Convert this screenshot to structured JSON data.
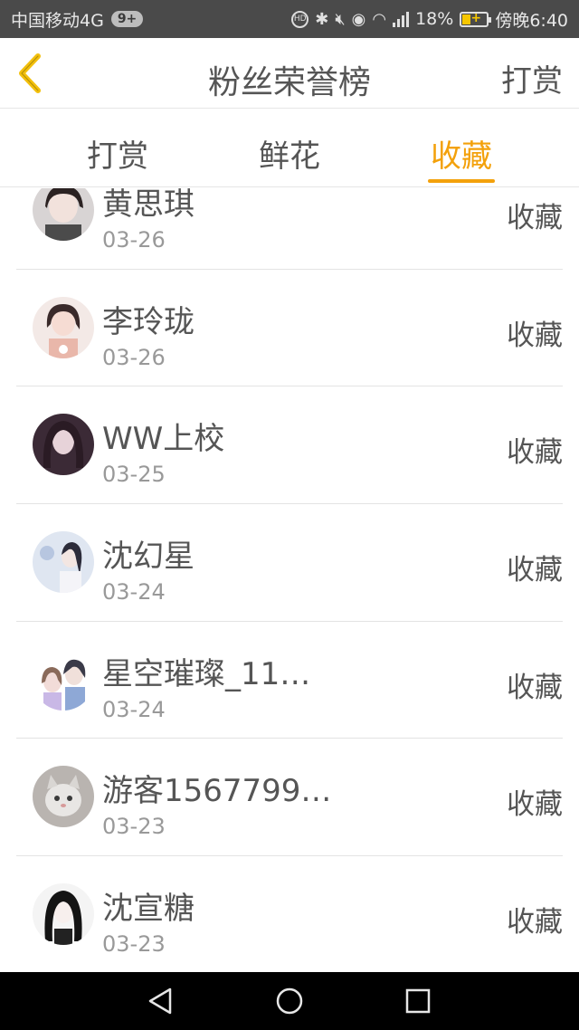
{
  "status_bar": {
    "carrier": "中国移动4G",
    "badge": "9+",
    "battery": "18%",
    "time": "傍晚6:40",
    "network": "4G"
  },
  "header": {
    "title": "粉丝荣誉榜",
    "action_label": "打赏",
    "back_icon": "chevron-left-icon"
  },
  "tabs": [
    {
      "label": "打赏",
      "active": false
    },
    {
      "label": "鲜花",
      "active": false
    },
    {
      "label": "收藏",
      "active": true
    }
  ],
  "accent_color": "#f3a10b",
  "list": {
    "items": [
      {
        "name": "黄思琪",
        "date": "03-26",
        "action": "收藏"
      },
      {
        "name": "李玲珑",
        "date": "03-26",
        "action": "收藏"
      },
      {
        "name": "WW上校",
        "date": "03-25",
        "action": "收藏"
      },
      {
        "name": "沈幻星",
        "date": "03-24",
        "action": "收藏"
      },
      {
        "name": "星空璀璨_11…",
        "date": "03-24",
        "action": "收藏"
      },
      {
        "name": "游客1567799…",
        "date": "03-23",
        "action": "收藏"
      },
      {
        "name": "沈宣糖",
        "date": "03-23",
        "action": "收藏"
      }
    ]
  }
}
